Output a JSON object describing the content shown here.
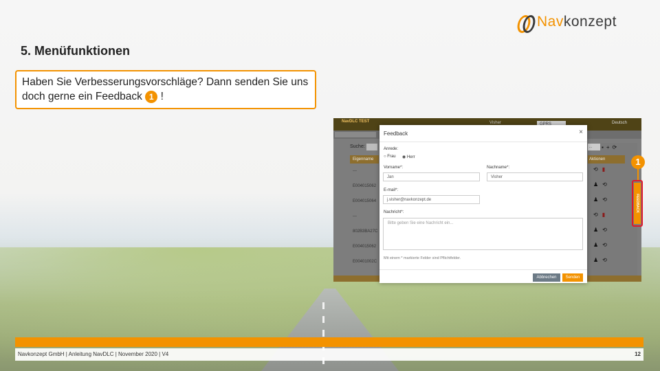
{
  "slide": {
    "title": "5. Menüfunktionen",
    "callout_text": "Haben Sie Verbesserungsvorschläge? Dann senden Sie uns doch gerne ein Feedback",
    "callout_after": "!",
    "badge": "1"
  },
  "logo": {
    "text_nav": "Nav",
    "text_rest": "konzept"
  },
  "embedded_app": {
    "brand": "NavDLC TEST",
    "user_menu": "Visher",
    "network_select": "GPRS",
    "language": "Deutsch",
    "search_label": "Suche:",
    "search_right_placeholder": "...",
    "table_header": "Eigenname",
    "right_header": "Aktionen",
    "rows": [
      "---",
      "E004015062",
      "E004015064",
      "---",
      "802B3BA27C",
      "E004015062",
      "E00401002C"
    ]
  },
  "feedback_dialog": {
    "title": "Feedback",
    "close": "×",
    "anrede_label": "Anrede:",
    "option_frau": "Frau",
    "option_herr": "Herr",
    "vorname_label": "Vorname*:",
    "vorname_value": "Jan",
    "nachname_label": "Nachname*:",
    "nachname_value": "Visher",
    "email_label": "E-mail*:",
    "email_value": "j.visher@navkonzept.de",
    "nachricht_label": "Nachricht*:",
    "nachricht_placeholder": "Bitte geben Sie eine Nachricht ein...",
    "hint": "Mit einem * markierte Felder sind Pflichtfelder.",
    "cancel": "Abbrechen",
    "send": "Senden"
  },
  "feedback_tab": {
    "label": "FEEDBACK",
    "badge": "1"
  },
  "footer": {
    "text": "Navkonzept GmbH  |  Anleitung NavDLC  |  November 2020  |  V4",
    "page": "12"
  },
  "colors": {
    "accent": "#f39200",
    "highlight": "#e0182b"
  }
}
